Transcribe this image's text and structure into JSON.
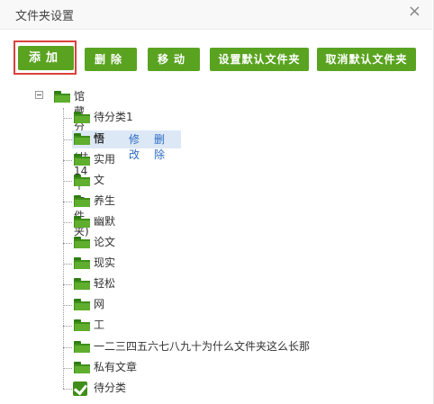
{
  "dialog": {
    "title": "文件夹设置",
    "close_symbol": "×"
  },
  "toolbar": {
    "add_label": "添加",
    "delete_label": "删除",
    "move_label": "移动",
    "set_default_label": "设置默认文件夹",
    "cancel_default_label": "取消默认文件夹"
  },
  "tree": {
    "root_label": "馆藏分类(共14个文件夹)",
    "items": [
      {
        "label": "待分类1"
      },
      {
        "label": "悟",
        "selected": true,
        "edit_label": "修改",
        "delete_label": "删除"
      },
      {
        "label": "实用"
      },
      {
        "label": "文"
      },
      {
        "label": "养生"
      },
      {
        "label": "幽默"
      },
      {
        "label": "论文"
      },
      {
        "label": "现实"
      },
      {
        "label": "轻松"
      },
      {
        "label": "网"
      },
      {
        "label": "工"
      },
      {
        "label": "一二三四五六七八九十为什么文件夹这么长那"
      },
      {
        "label": "私有文章"
      },
      {
        "label": "待分类",
        "checked": true
      }
    ]
  },
  "colors": {
    "button_green": "#5aa320",
    "highlight_red": "#d9413b",
    "selection_blue": "#dde8f6",
    "link_blue": "#2a6bc4",
    "folder_green": "#3f8f1a"
  }
}
